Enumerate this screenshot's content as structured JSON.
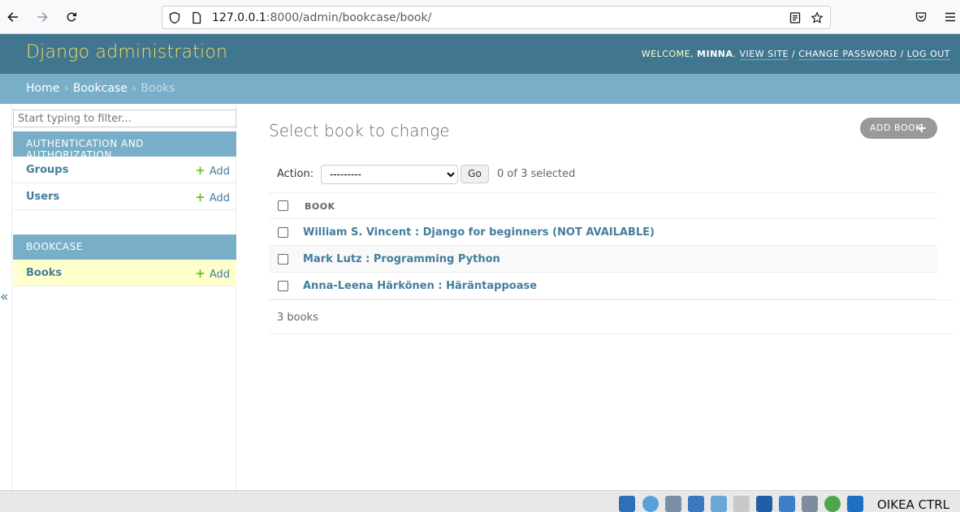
{
  "browser": {
    "url_host": "127.0.0.1",
    "url_rest": ":8000/admin/bookcase/book/"
  },
  "header": {
    "branding": "Django administration",
    "welcome": "WELCOME, ",
    "user": "MINNA",
    "links": [
      "VIEW SITE",
      "CHANGE PASSWORD",
      "LOG OUT"
    ]
  },
  "breadcrumbs": {
    "home": "Home",
    "app": "Bookcase",
    "current": "Books",
    "sep": "›"
  },
  "sidebar": {
    "filter_placeholder": "Start typing to filter...",
    "modules": [
      {
        "caption": "AUTHENTICATION AND AUTHORIZATION",
        "items": [
          {
            "label": "Groups",
            "add": "Add"
          },
          {
            "label": "Users",
            "add": "Add"
          }
        ]
      },
      {
        "caption": "BOOKCASE",
        "items": [
          {
            "label": "Books",
            "add": "Add"
          }
        ]
      }
    ],
    "toggle": "«"
  },
  "content": {
    "title": "Select book to change",
    "add_button": "ADD BOOK",
    "action_label": "Action:",
    "action_selected": "---------",
    "go": "Go",
    "counter": "0 of 3 selected",
    "column": "BOOK",
    "rows": [
      "William S. Vincent : Django for beginners (NOT AVAILABLE)",
      "Mark Lutz : Programming Python",
      "Anna-Leena Härkönen : Häräntappoase"
    ],
    "paginator": "3 books"
  },
  "taskbar": {
    "text": "OIKEA CTRL"
  }
}
